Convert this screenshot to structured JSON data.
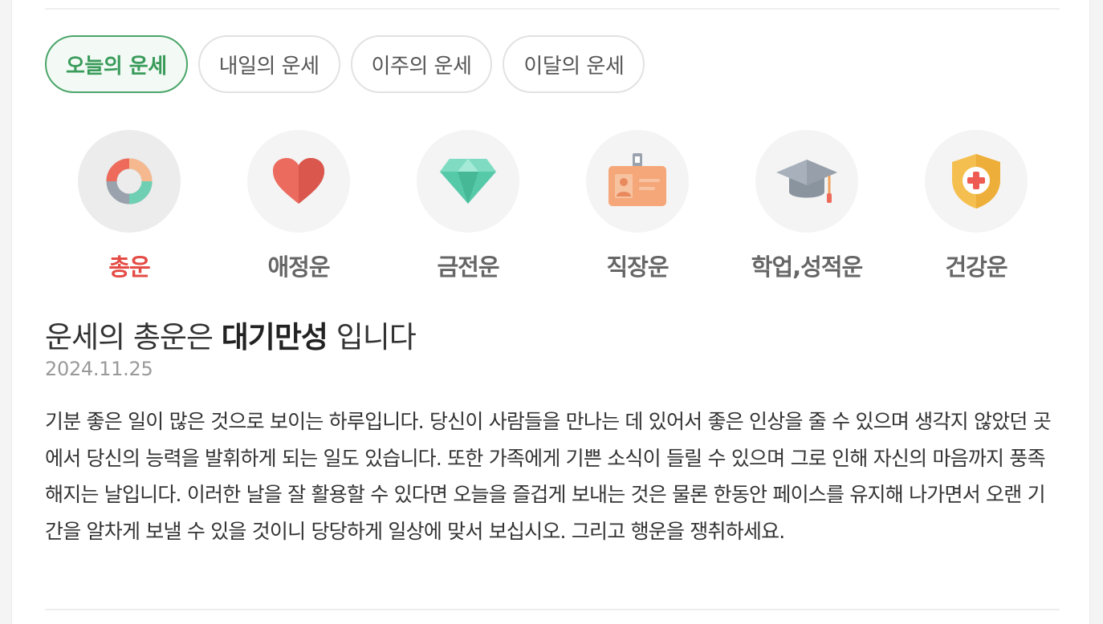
{
  "tabs": [
    {
      "label": "오늘의 운세",
      "active": true
    },
    {
      "label": "내일의 운세",
      "active": false
    },
    {
      "label": "이주의 운세",
      "active": false
    },
    {
      "label": "이달의 운세",
      "active": false
    }
  ],
  "categories": [
    {
      "label": "총운",
      "icon": "donut-chart-icon",
      "active": true
    },
    {
      "label": "애정운",
      "icon": "heart-icon",
      "active": false
    },
    {
      "label": "금전운",
      "icon": "diamond-icon",
      "active": false
    },
    {
      "label": "직장운",
      "icon": "id-badge-icon",
      "active": false
    },
    {
      "label": "학업,성적운",
      "icon": "graduation-cap-icon",
      "active": false
    },
    {
      "label": "건강운",
      "icon": "medical-shield-icon",
      "active": false
    }
  ],
  "result": {
    "prefix": "운세의 총운은 ",
    "keyword": "대기만성",
    "suffix": " 입니다",
    "date": "2024.11.25",
    "description": "기분 좋은 일이 많은 것으로 보이는 하루입니다. 당신이 사람들을 만나는 데 있어서 좋은 인상을 줄 수 있으며 생각지 않았던 곳에서 당신의 능력을 발휘하게 되는 일도 있습니다. 또한 가족에게 기쁜 소식이 들릴 수 있으며 그로 인해 자신의 마음까지 풍족해지는 날입니다. 이러한 날을 잘 활용할 수 있다면 오늘을 즐겁게 보내는 것은 물론 한동안 페이스를 유지해 나가면서 오랜 기간을 알차게 보낼 수 있을 것이니 당당하게 일상에 맞서 보십시오. 그리고 행운을 쟁취하세요."
  },
  "colors": {
    "active_tab": "#3a9b5b",
    "active_category": "#e44c45",
    "inactive_label": "#666666"
  }
}
